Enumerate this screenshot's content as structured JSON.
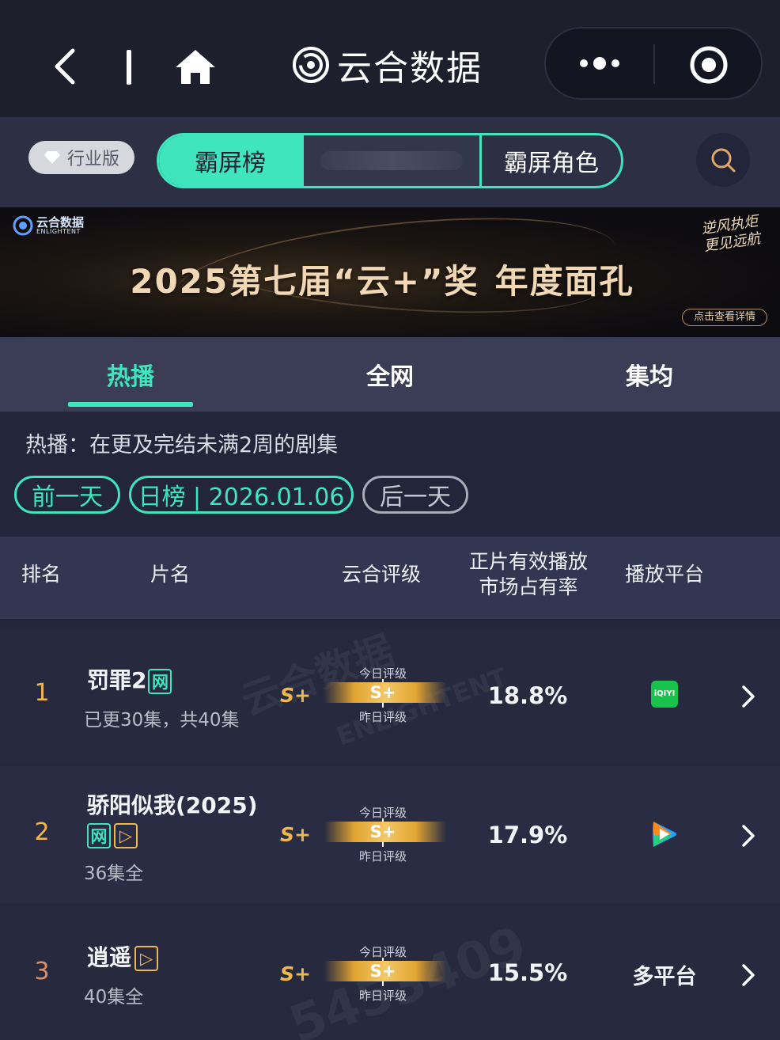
{
  "nav": {
    "title": "云合数据"
  },
  "switchbar": {
    "edition_label": "行业版",
    "segments": [
      "霸屏榜",
      "",
      "霸屏角色"
    ]
  },
  "banner": {
    "title_part1": "2025第七届“云+”奖",
    "title_part2": "年度面孔",
    "logo_cn": "云合数据",
    "logo_en": "ENLIGHTENT",
    "script_line1": "逆风执炬",
    "script_line2": "更见远航",
    "detail_button": "点击查看详情"
  },
  "tabs": [
    {
      "label": "热播",
      "active": true
    },
    {
      "label": "全网",
      "active": false
    },
    {
      "label": "集均",
      "active": false
    }
  ],
  "description": "热播：在更及完结未满2周的剧集",
  "date_nav": {
    "prev": "前一天",
    "current": "日榜 | 2026.01.06",
    "next": "后一天"
  },
  "table": {
    "headers": {
      "rank": "排名",
      "name": "片名",
      "rating": "云合评级",
      "share_line1": "正片有效播放",
      "share_line2": "市场占有率",
      "platform": "播放平台"
    },
    "gauge_today_label": "今日评级",
    "gauge_yesterday_label": "昨日评级",
    "rows": [
      {
        "rank": "1",
        "name": "罚罪2",
        "tag1": "网",
        "tag2": "",
        "status": "已更30集，共40集",
        "yesterday_rating": "S+",
        "today_rating": "S+",
        "share": "18.8%",
        "platform": "iQIYI"
      },
      {
        "rank": "2",
        "name": "骄阳似我(2025)",
        "tag1": "网",
        "tag2": "▷",
        "status": "36集全",
        "yesterday_rating": "S+",
        "today_rating": "S+",
        "share": "17.9%",
        "platform": "腾讯视频"
      },
      {
        "rank": "3",
        "name": "逍遥",
        "tag1": "",
        "tag2": "▷",
        "status": "40集全",
        "yesterday_rating": "S+",
        "today_rating": "S+",
        "share": "15.5%",
        "platform": "多平台"
      }
    ]
  },
  "watermark": {
    "row1_cn": "云合数据",
    "row1_en": "ENLIGHTENT",
    "row3_num": "5453409"
  },
  "colors": {
    "accent": "#3ee5bd",
    "rank_top": "#f0b84a",
    "rank_third": "#d8906a",
    "gold": "#e3a532"
  }
}
